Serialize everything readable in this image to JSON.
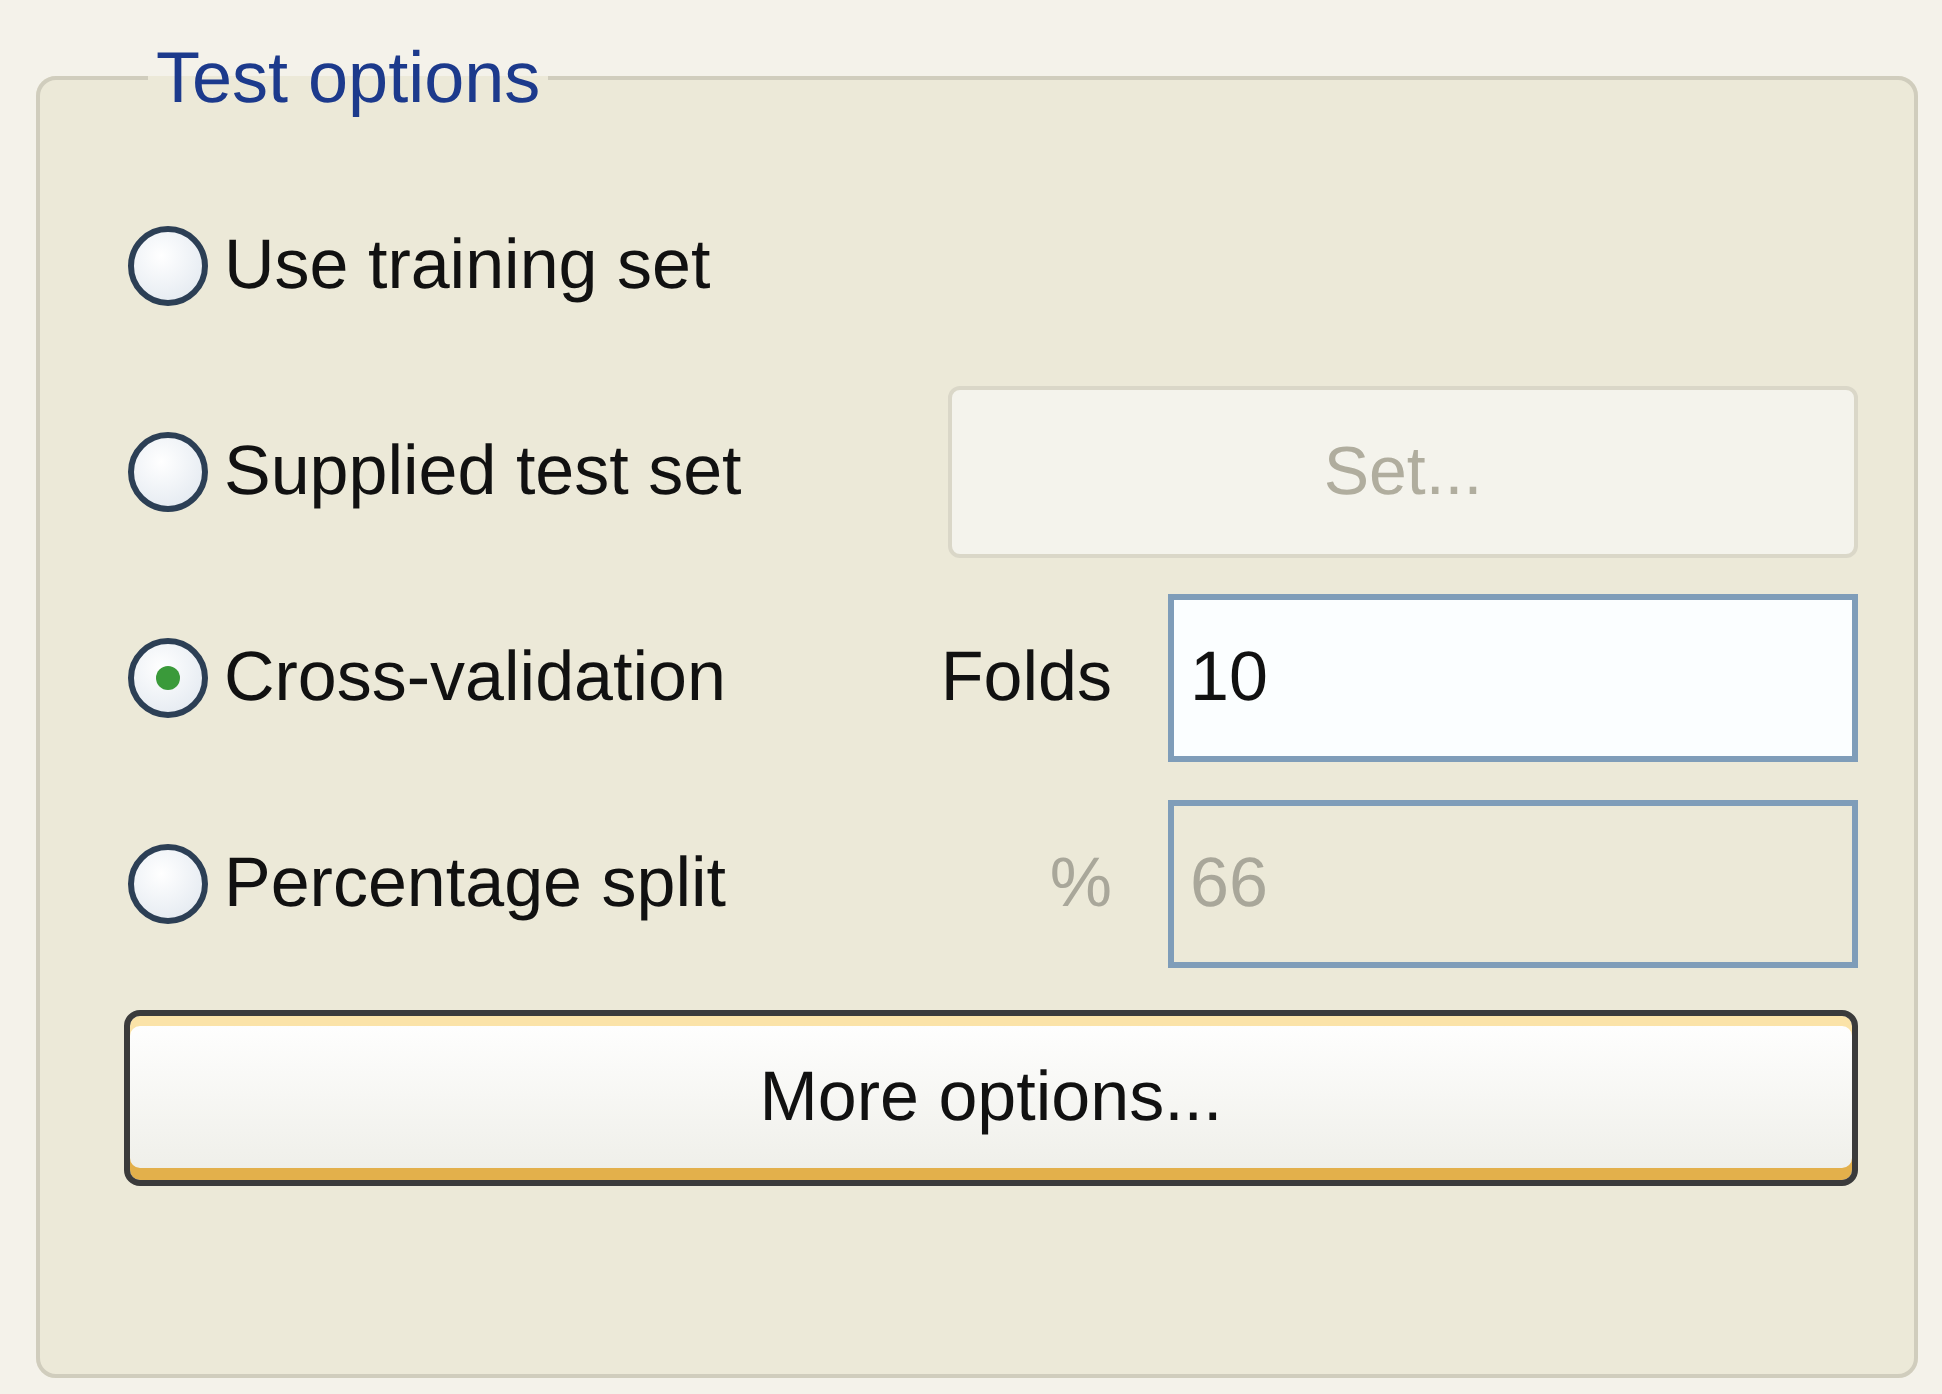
{
  "group": {
    "title": "Test options"
  },
  "options": [
    {
      "label": "Use training set",
      "selected": false
    },
    {
      "label": "Supplied test set",
      "selected": false,
      "control": {
        "kind": "button",
        "label": "Set...",
        "disabled": true
      }
    },
    {
      "label": "Cross-validation",
      "selected": true,
      "control": {
        "kind": "field",
        "label": "Folds",
        "value": "10",
        "disabled": false
      }
    },
    {
      "label": "Percentage split",
      "selected": false,
      "control": {
        "kind": "field",
        "label": "%",
        "value": "66",
        "disabled": true
      }
    }
  ],
  "more_button": {
    "label": "More options..."
  }
}
